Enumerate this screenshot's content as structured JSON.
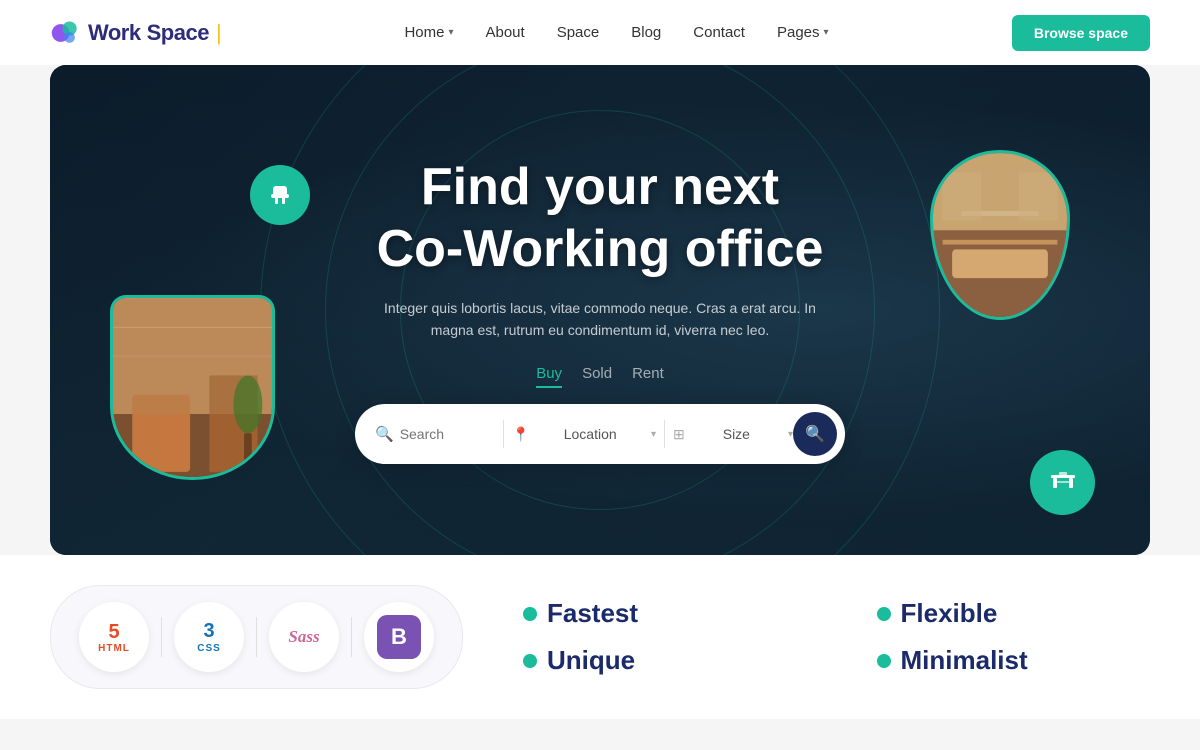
{
  "navbar": {
    "logo": {
      "work": "Work",
      "space": "Space",
      "bar": "|"
    },
    "links": [
      {
        "label": "Home",
        "hasDropdown": true
      },
      {
        "label": "About",
        "hasDropdown": false
      },
      {
        "label": "Space",
        "hasDropdown": false
      },
      {
        "label": "Blog",
        "hasDropdown": false
      },
      {
        "label": "Contact",
        "hasDropdown": false
      },
      {
        "label": "Pages",
        "hasDropdown": true
      }
    ],
    "cta": "Browse space"
  },
  "hero": {
    "title_line1": "Find your next",
    "title_line2": "Co-Working office",
    "subtitle": "Integer quis lobortis lacus, vitae commodo neque. Cras a erat arcu. In magna est, rutrum eu condimentum id, viverra nec leo.",
    "tabs": [
      {
        "label": "Buy",
        "active": true
      },
      {
        "label": "Sold",
        "active": false
      },
      {
        "label": "Rent",
        "active": false
      }
    ],
    "search": {
      "placeholder": "Search",
      "location_label": "Location",
      "size_label": "Size"
    }
  },
  "tech_stack": {
    "badges": [
      {
        "id": "html",
        "label": "HTML",
        "num": "5"
      },
      {
        "id": "css",
        "label": "CSS",
        "num": "3"
      },
      {
        "id": "sass",
        "label": "Sass"
      },
      {
        "id": "bootstrap",
        "label": "B"
      }
    ]
  },
  "features": [
    {
      "label": "Fastest"
    },
    {
      "label": "Flexible"
    },
    {
      "label": "Unique"
    },
    {
      "label": "Minimalist"
    }
  ]
}
